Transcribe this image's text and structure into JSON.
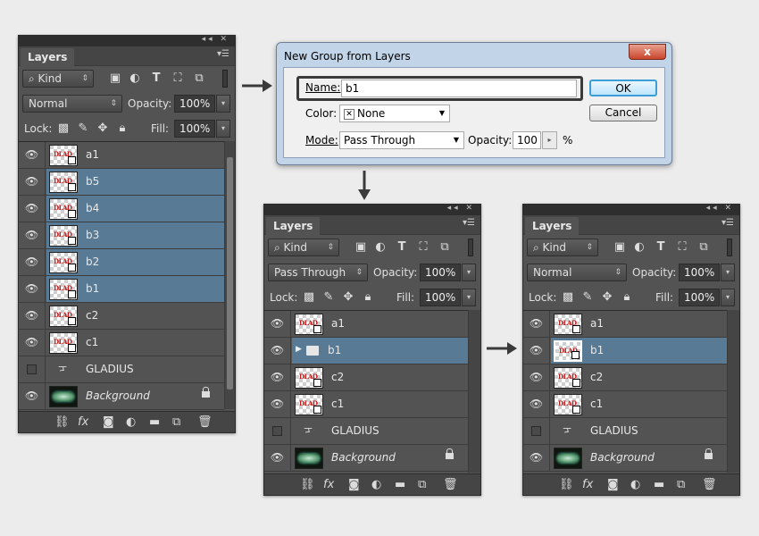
{
  "panel_left": {
    "tab": "Layers",
    "filter_kind": "Kind",
    "blend_mode": "Normal",
    "opacity_label": "Opacity:",
    "opacity_value": "100%",
    "lock_label": "Lock:",
    "fill_label": "Fill:",
    "fill_value": "100%",
    "layers": [
      {
        "name": "a1",
        "visible": true,
        "selected": false,
        "thumb": "text-art"
      },
      {
        "name": "b5",
        "visible": true,
        "selected": true,
        "thumb": "text-art"
      },
      {
        "name": "b4",
        "visible": true,
        "selected": true,
        "thumb": "text-art"
      },
      {
        "name": "b3",
        "visible": true,
        "selected": true,
        "thumb": "text-art"
      },
      {
        "name": "b2",
        "visible": true,
        "selected": true,
        "thumb": "text-art"
      },
      {
        "name": "b1",
        "visible": true,
        "selected": true,
        "thumb": "text-art"
      },
      {
        "name": "c2",
        "visible": true,
        "selected": false,
        "thumb": "text-art"
      },
      {
        "name": "c1",
        "visible": true,
        "selected": false,
        "thumb": "text-art"
      },
      {
        "name": "GLADIUS",
        "visible": false,
        "selected": false,
        "thumb": "text-layer"
      },
      {
        "name": "Background",
        "visible": true,
        "selected": false,
        "thumb": "background",
        "locked": true
      }
    ]
  },
  "panel_mid": {
    "tab": "Layers",
    "filter_kind": "Kind",
    "blend_mode": "Pass Through",
    "opacity_label": "Opacity:",
    "opacity_value": "100%",
    "lock_label": "Lock:",
    "fill_label": "Fill:",
    "fill_value": "100%",
    "layers": [
      {
        "name": "a1",
        "visible": true,
        "selected": false,
        "thumb": "text-art"
      },
      {
        "name": "b1",
        "visible": true,
        "selected": true,
        "thumb": "folder"
      },
      {
        "name": "c2",
        "visible": true,
        "selected": false,
        "thumb": "text-art"
      },
      {
        "name": "c1",
        "visible": true,
        "selected": false,
        "thumb": "text-art"
      },
      {
        "name": "GLADIUS",
        "visible": false,
        "selected": false,
        "thumb": "text-layer"
      },
      {
        "name": "Background",
        "visible": true,
        "selected": false,
        "thumb": "background",
        "locked": true
      }
    ]
  },
  "panel_right": {
    "tab": "Layers",
    "filter_kind": "Kind",
    "blend_mode": "Normal",
    "opacity_label": "Opacity:",
    "opacity_value": "100%",
    "lock_label": "Lock:",
    "fill_label": "Fill:",
    "fill_value": "100%",
    "layers": [
      {
        "name": "a1",
        "visible": true,
        "selected": false,
        "thumb": "text-art"
      },
      {
        "name": "b1",
        "visible": true,
        "selected": true,
        "thumb": "text-art-merged"
      },
      {
        "name": "c2",
        "visible": true,
        "selected": false,
        "thumb": "text-art"
      },
      {
        "name": "c1",
        "visible": true,
        "selected": false,
        "thumb": "text-art"
      },
      {
        "name": "GLADIUS",
        "visible": false,
        "selected": false,
        "thumb": "text-layer"
      },
      {
        "name": "Background",
        "visible": true,
        "selected": false,
        "thumb": "background",
        "locked": true
      }
    ]
  },
  "dialog": {
    "title": "New Group from Layers",
    "close": "x",
    "name_label": "Name:",
    "name_value": "b1",
    "color_label": "Color:",
    "color_value": "None",
    "mode_label": "Mode:",
    "mode_value": "Pass Through",
    "opacity_label": "Opacity:",
    "opacity_value": "100",
    "percent": "%",
    "ok": "OK",
    "cancel": "Cancel"
  },
  "thumb_text": "DLAD",
  "colors": {
    "panel_bg": "#535353",
    "selection": "#587a95",
    "dialog_frame": "#c2d4e8"
  }
}
